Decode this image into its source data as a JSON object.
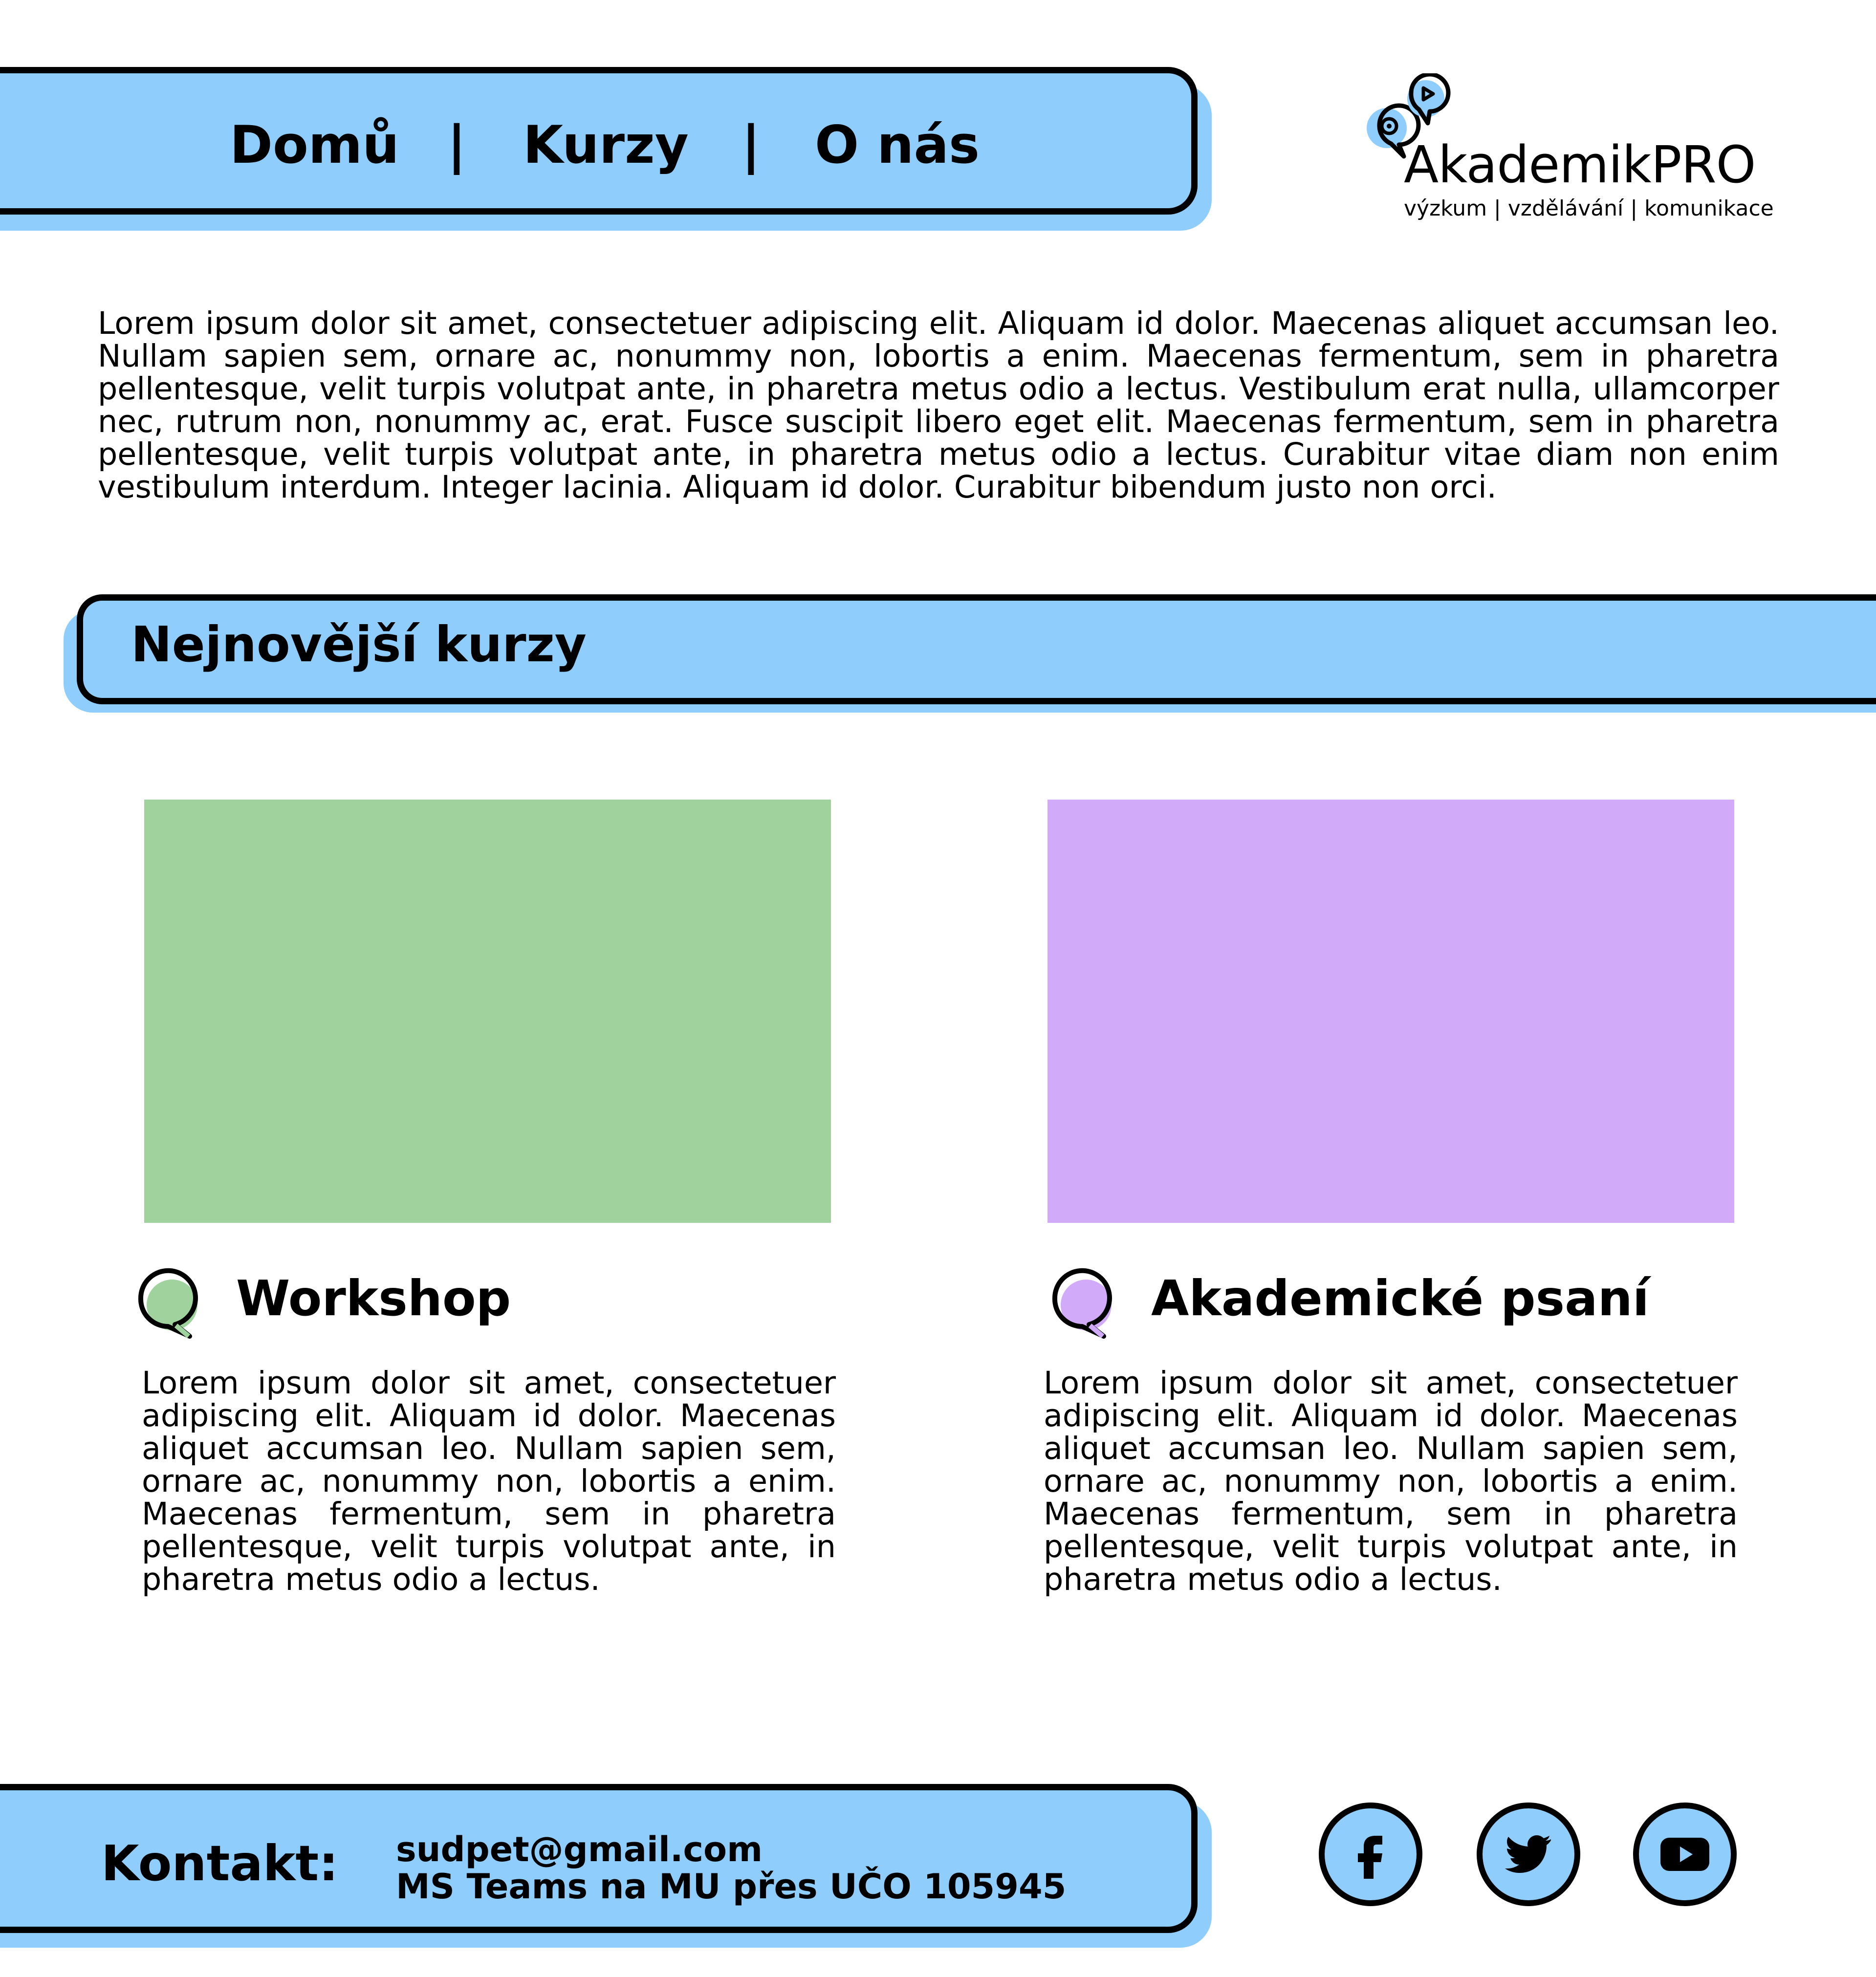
{
  "nav": {
    "items": [
      {
        "label": "Domů"
      },
      {
        "label": "Kurzy"
      },
      {
        "label": "O nás"
      }
    ],
    "separator": "|"
  },
  "logo": {
    "name": "AkademikPRO",
    "tagline": "výzkum | vzdělávání | komunikace"
  },
  "intro": {
    "text": "Lorem ipsum dolor sit amet, consectetuer adipiscing elit. Aliquam id dolor. Maecenas aliquet accumsan leo. Nullam sapien sem, ornare ac, nonummy non, lobortis a enim. Maecenas fermentum, sem in pharetra pellentesque, velit turpis volutpat ante, in pharetra metus odio a lectus. Vestibulum erat nulla, ullamcorper nec, rutrum non, nonummy ac, erat. Fusce suscipit libero eget elit. Maecenas fermentum, sem in pharetra pellentesque, velit turpis volutpat ante, in pharetra metus odio a lectus. Curabitur vitae diam non enim vestibulum interdum. Integer lacinia. Aliquam id dolor. Curabitur bibendum justo non orci."
  },
  "section": {
    "title": "Nejnovější kurzy"
  },
  "courses": [
    {
      "title": "Workshop",
      "color": "#9fd29d",
      "description": "Lorem ipsum dolor sit amet, consectetuer adipiscing elit. Aliquam id dolor. Maecenas aliquet accumsan leo. Nullam sapien sem, ornare ac, nonummy non, lobortis a enim. Maecenas fermentum, sem in pharetra pellentesque, velit turpis volutpat ante, in pharetra metus odio a lectus."
    },
    {
      "title": "Akademické psaní",
      "color": "#d1abf9",
      "description": "Lorem ipsum dolor sit amet, consectetuer adipiscing elit. Aliquam id dolor. Maecenas aliquet accumsan leo. Nullam sapien sem, ornare ac, nonummy non, lobortis a enim. Maecenas fermentum, sem in pharetra pellentesque, velit turpis volutpat ante, in pharetra metus odio a lectus."
    }
  ],
  "footer": {
    "contact_label": "Kontakt:",
    "email": "sudpet@gmail.com",
    "teams": "MS Teams na MU přes UČO 105945"
  },
  "social": [
    {
      "icon": "facebook-icon"
    },
    {
      "icon": "twitter-icon"
    },
    {
      "icon": "youtube-icon"
    }
  ],
  "colors": {
    "accent_blue": "#8ecdfc",
    "green": "#9fd29d",
    "purple": "#d1abf9",
    "outline": "#000000"
  }
}
